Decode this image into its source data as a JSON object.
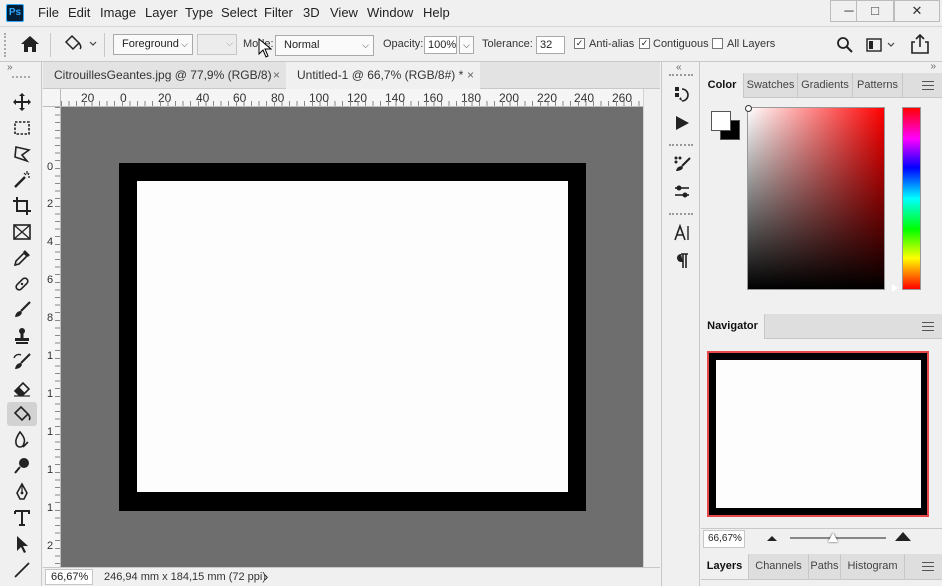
{
  "app": {
    "logo": "Ps",
    "menu": [
      "File",
      "Edit",
      "Image",
      "Layer",
      "Type",
      "Select",
      "Filter",
      "3D",
      "View",
      "Window",
      "Help"
    ],
    "window_controls": [
      "─",
      "□",
      "✕"
    ]
  },
  "options_bar": {
    "fill_source": "Foreground",
    "mode_label": "Mode:",
    "mode_value": "Normal",
    "opacity_label": "Opacity:",
    "opacity_value": "100%",
    "tolerance_label": "Tolerance:",
    "tolerance_value": "32",
    "anti_alias_label": "Anti-alias",
    "anti_alias_checked": true,
    "contiguous_label": "Contiguous",
    "contiguous_checked": true,
    "all_layers_label": "All Layers",
    "all_layers_checked": false
  },
  "documents": {
    "tabs": [
      {
        "label": "CitrouillesGeantes.jpg @ 77,9% (RGB/8)",
        "active": false
      },
      {
        "label": "Untitled-1 @ 66,7% (RGB/8#) *",
        "active": true
      }
    ],
    "close_glyph": "×"
  },
  "rulers": {
    "horizontal": [
      "20",
      "0",
      "20",
      "40",
      "60",
      "80",
      "100",
      "120",
      "140",
      "160",
      "180",
      "200",
      "220",
      "240",
      "260"
    ],
    "vertical": [
      "0",
      "2",
      "4",
      "6",
      "8",
      "1",
      "1",
      "1",
      "1",
      "1",
      "2"
    ]
  },
  "status_bar": {
    "zoom": "66,67%",
    "doc_size": "246,94 mm x 184,15 mm (72 ppi)",
    "arrow": "›"
  },
  "tools": [
    "move-tool-icon",
    "marquee-tool-icon",
    "lasso-tool-icon",
    "magic-wand-icon",
    "crop-tool-icon",
    "frame-tool-icon",
    "eyedropper-icon",
    "healing-brush-icon",
    "brush-tool-icon",
    "clone-stamp-icon",
    "history-brush-icon",
    "eraser-icon",
    "paint-bucket-icon",
    "blur-tool-icon",
    "dodge-tool-icon",
    "pen-tool-icon",
    "type-tool-icon",
    "path-selection-icon",
    "line-tool-icon"
  ],
  "color_panel": {
    "tabs": [
      "Color",
      "Swatches",
      "Gradients",
      "Patterns"
    ],
    "active_tab": "Color",
    "foreground_color": "#ffffff",
    "background_color": "#000000"
  },
  "navigator_panel": {
    "title": "Navigator",
    "zoom": "66,67%",
    "view_box_color": "#e84848"
  },
  "layers_panel": {
    "tabs": [
      "Layers",
      "Channels",
      "Paths",
      "Histogram"
    ],
    "active_tab": "Layers"
  }
}
